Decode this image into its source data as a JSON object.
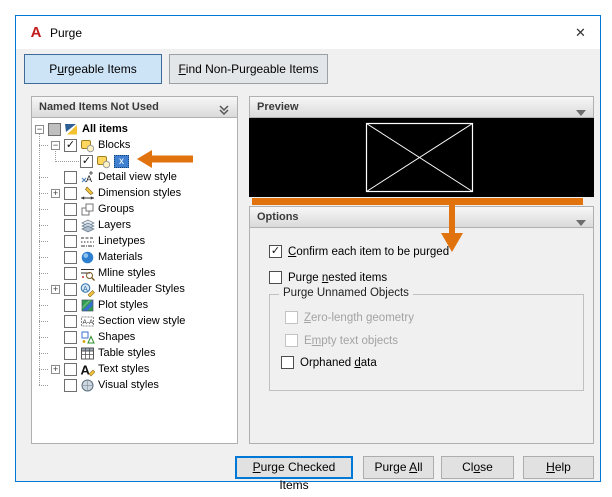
{
  "window": {
    "title": "Purge"
  },
  "glyphs": {
    "logo": "A",
    "close": "✕",
    "check": "✓",
    "minus": "−",
    "plus": "+"
  },
  "colors": {
    "accent_blue": "#0078d7",
    "annotation_orange": "#e1730f",
    "selection_blue": "#3f80d0",
    "selected_tab_bg": "#cde4f6"
  },
  "tabs": [
    {
      "pre": "P",
      "key": "u",
      "post": "rgeable Items",
      "selected": true
    },
    {
      "pre": "",
      "key": "F",
      "post": "ind Non-Purgeable Items",
      "selected": false
    }
  ],
  "tree": {
    "header": "Named Items Not Used",
    "items": [
      {
        "label": "All items",
        "icon": "all-items-icon",
        "level": 0,
        "checkbox": "indeterminate",
        "expander": "minus",
        "bold": true,
        "selected": false
      },
      {
        "label": "Blocks",
        "icon": "block-icon",
        "level": 1,
        "checkbox": "checked",
        "expander": "minus",
        "bold": false,
        "selected": false
      },
      {
        "label": "x",
        "icon": "block-icon",
        "level": 2,
        "checkbox": "checked",
        "expander": "none",
        "bold": false,
        "selected": true
      },
      {
        "label": "Detail view style",
        "icon": "detail-view-style-icon",
        "level": 1,
        "checkbox": "unchecked",
        "expander": "none",
        "bold": false,
        "selected": false
      },
      {
        "label": "Dimension styles",
        "icon": "dimension-style-icon",
        "level": 1,
        "checkbox": "unchecked",
        "expander": "plus",
        "bold": false,
        "selected": false
      },
      {
        "label": "Groups",
        "icon": "groups-icon",
        "level": 1,
        "checkbox": "unchecked",
        "expander": "none",
        "bold": false,
        "selected": false
      },
      {
        "label": "Layers",
        "icon": "layers-icon",
        "level": 1,
        "checkbox": "unchecked",
        "expander": "none",
        "bold": false,
        "selected": false
      },
      {
        "label": "Linetypes",
        "icon": "linetype-icon",
        "level": 1,
        "checkbox": "unchecked",
        "expander": "none",
        "bold": false,
        "selected": false
      },
      {
        "label": "Materials",
        "icon": "materials-icon",
        "level": 1,
        "checkbox": "unchecked",
        "expander": "none",
        "bold": false,
        "selected": false
      },
      {
        "label": "Mline styles",
        "icon": "mline-style-icon",
        "level": 1,
        "checkbox": "unchecked",
        "expander": "none",
        "bold": false,
        "selected": false
      },
      {
        "label": "Multileader Styles",
        "icon": "multileader-style-icon",
        "level": 1,
        "checkbox": "unchecked",
        "expander": "plus",
        "bold": false,
        "selected": false
      },
      {
        "label": "Plot styles",
        "icon": "plot-style-icon",
        "level": 1,
        "checkbox": "unchecked",
        "expander": "none",
        "bold": false,
        "selected": false
      },
      {
        "label": "Section view style",
        "icon": "section-view-style-icon",
        "level": 1,
        "checkbox": "unchecked",
        "expander": "none",
        "bold": false,
        "selected": false
      },
      {
        "label": "Shapes",
        "icon": "shapes-icon",
        "level": 1,
        "checkbox": "unchecked",
        "expander": "none",
        "bold": false,
        "selected": false
      },
      {
        "label": "Table styles",
        "icon": "table-style-icon",
        "level": 1,
        "checkbox": "unchecked",
        "expander": "none",
        "bold": false,
        "selected": false
      },
      {
        "label": "Text styles",
        "icon": "text-style-icon",
        "level": 1,
        "checkbox": "unchecked",
        "expander": "plus",
        "bold": false,
        "selected": false
      },
      {
        "label": "Visual styles",
        "icon": "visual-style-icon",
        "level": 1,
        "checkbox": "unchecked",
        "expander": "none",
        "bold": false,
        "selected": false
      }
    ]
  },
  "preview": {
    "title": "Preview"
  },
  "options": {
    "title": "Options",
    "checkboxes": [
      {
        "pre": "",
        "key": "C",
        "post": "onfirm each item to be purged",
        "state": "checked",
        "enabled": true
      },
      {
        "pre": "Purge ",
        "key": "n",
        "post": "ested items",
        "state": "unchecked",
        "enabled": true
      }
    ],
    "group": {
      "label": "Purge Unnamed Objects",
      "checkboxes": [
        {
          "pre": "",
          "key": "Z",
          "post": "ero-length geometry",
          "state": "unchecked",
          "enabled": false
        },
        {
          "pre": "E",
          "key": "m",
          "post": "pty text objects",
          "state": "unchecked",
          "enabled": false
        },
        {
          "pre": "Orphaned ",
          "key": "d",
          "post": "ata",
          "state": "unchecked",
          "enabled": true
        }
      ]
    }
  },
  "buttons": [
    {
      "pre": "",
      "key": "P",
      "post": "urge Checked Items",
      "default": true
    },
    {
      "pre": "Purge ",
      "key": "A",
      "post": "ll",
      "default": false
    },
    {
      "pre": "Cl",
      "key": "o",
      "post": "se",
      "default": false
    },
    {
      "pre": "",
      "key": "H",
      "post": "elp",
      "default": false
    }
  ]
}
